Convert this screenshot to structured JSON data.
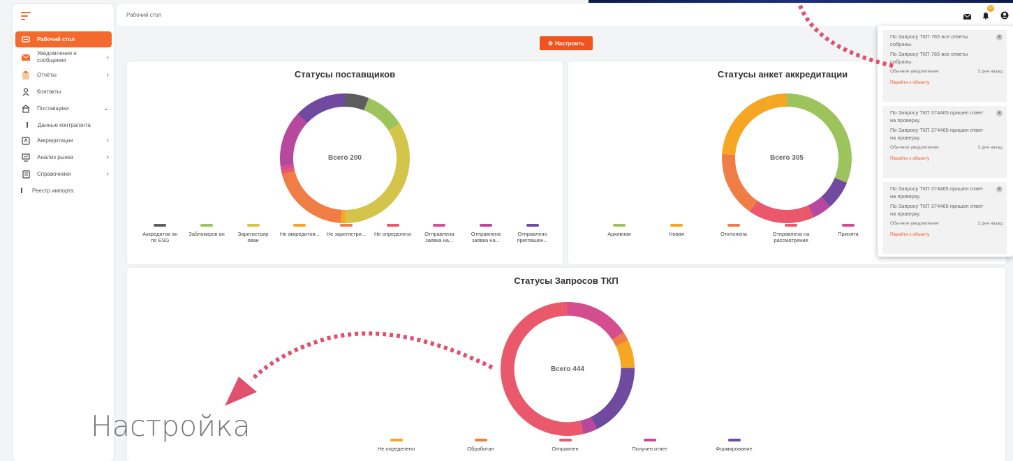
{
  "colors": {
    "accent": "#f26a2e",
    "button": "#f0531f"
  },
  "sidebar": {
    "toggle_icon": "hamburger-icon",
    "items": [
      {
        "label": "Рабочий стол",
        "icon": "desktop-icon",
        "active": true
      },
      {
        "label": "Уведомления и сообщения",
        "icon": "mail-icon",
        "chevron": true
      },
      {
        "label": "Отчёты",
        "icon": "clipboard-icon",
        "chevron": true
      },
      {
        "label": "Контакты",
        "icon": "person-icon"
      },
      {
        "label": "Поставщики",
        "icon": "supplier-icon",
        "chevron": "down"
      },
      {
        "label": "Данные контрагента",
        "sub": true
      },
      {
        "label": "Аккредитации",
        "icon": "accreditation-icon",
        "chevron": true
      },
      {
        "label": "Анализ рынка",
        "icon": "monitor-icon",
        "chevron": true
      },
      {
        "label": "Справочники",
        "icon": "book-icon",
        "chevron": true
      },
      {
        "label": "Реестр импорта",
        "sub": true
      }
    ]
  },
  "header": {
    "breadcrumb": "Рабочий стол",
    "notification_count": "10",
    "icons": [
      "mail-icon",
      "bell-icon",
      "user-icon"
    ]
  },
  "config_button": {
    "label": "Настроить",
    "icon": "gear-icon"
  },
  "chart_data": [
    {
      "type": "pie",
      "title": "Статусы поставщиков",
      "center_text": "Всего 200",
      "series": [
        {
          "name": "Аккредитован по ESG",
          "value": 12,
          "color": "#5d5d5d"
        },
        {
          "name": "Заблокирован",
          "value": 20,
          "color": "#9dc35c"
        },
        {
          "name": "Зарегистрирован",
          "value": 68,
          "color": "#d4c54a"
        },
        {
          "name": "Не аккредитован",
          "value": 2,
          "color": "#f5a623"
        },
        {
          "name": "Не зарегистрирован",
          "value": 40,
          "color": "#f07d46"
        },
        {
          "name": "Не определено",
          "value": 2,
          "color": "#e9586b"
        },
        {
          "name": "Отправлена заявка на аккредитацию",
          "value": 2,
          "color": "#d44d8f"
        },
        {
          "name": "Отправлена заявка на регистрацию",
          "value": 28,
          "color": "#b8479e"
        },
        {
          "name": "Отправлено приглашение",
          "value": 26,
          "color": "#6f4a9e"
        }
      ],
      "legend_labels": [
        "Аккредитов ан по ESG",
        "Заблокиров ан",
        "Зарегистрир ован",
        "Не аккредитов...",
        "Не зарегистри...",
        "Не определено",
        "Отправлена заявка на...",
        "Отправлена заявка на...",
        "Отправлено приглашен..."
      ]
    },
    {
      "type": "pie",
      "title": "Статусы анкет аккредитации",
      "center_text": "Всего 305",
      "series": [
        {
          "name": "Архивная",
          "value": 95,
          "color": "#9dc35c"
        },
        {
          "name": "Принята",
          "value": 22,
          "color": "#6f4a9e"
        },
        {
          "name": "Принята2",
          "value": 15,
          "color": "#b8479e"
        },
        {
          "name": "Отправлена на рассмотрение",
          "value": 50,
          "color": "#e9586b"
        },
        {
          "name": "Отклонена",
          "value": 50,
          "color": "#f07d46"
        },
        {
          "name": "Новая",
          "value": 73,
          "color": "#f5a623"
        }
      ],
      "legend_labels": [
        "Архивная",
        "Новая",
        "Отклонена",
        "Отправлена на рассмотрение",
        "Принята"
      ],
      "legend_colors": [
        "#9dc35c",
        "#f5a623",
        "#f07d46",
        "#e9586b",
        "#d44d8f"
      ]
    },
    {
      "type": "pie",
      "title": "Статусы Запросов ТКП",
      "center_text": "Всего 444",
      "series": [
        {
          "name": "Получен ответ",
          "value": 70,
          "color": "#d44d8f"
        },
        {
          "name": "Обработан",
          "value": 10,
          "color": "#f07d46"
        },
        {
          "name": "Не определено",
          "value": 30,
          "color": "#f5a623"
        },
        {
          "name": "Формирование",
          "value": 80,
          "color": "#6f4a9e"
        },
        {
          "name": "Получен ответ2",
          "value": 15,
          "color": "#b8479e"
        },
        {
          "name": "Отправлен",
          "value": 239,
          "color": "#e9586b"
        }
      ],
      "legend_labels": [
        "Не определено",
        "Обработан",
        "Отправлен",
        "Получен ответ",
        "Формирование"
      ],
      "legend_colors": [
        "#f5a623",
        "#f07d46",
        "#e9586b",
        "#c64b95",
        "#6f4a9e"
      ]
    }
  ],
  "notifications": [
    {
      "title": "По Запросу ТКП 765 все ответы собраны.",
      "body": "По Запросу ТКП 765 все ответы собраны.",
      "type": "Обычное уведомление",
      "time": "3 дня назад",
      "link": "Перейти к объекту"
    },
    {
      "title": "По Запросу ТКП 374465 пришел ответ на проверку.",
      "body": "По Запросу ТКП 374465 пришел ответ на проверку.",
      "type": "Обычное уведомление",
      "time": "3 дня назад",
      "link": "Перейти к объекту"
    },
    {
      "title": "По Запросу ТКП 374465 пришел ответ на проверку.",
      "body": "По Запросу ТКП 374465 пришел ответ на проверку.",
      "type": "Обычное уведомление",
      "time": "3 дня назад",
      "link": "Перейти к объекту"
    }
  ],
  "overlay": {
    "label": "Настройка"
  }
}
